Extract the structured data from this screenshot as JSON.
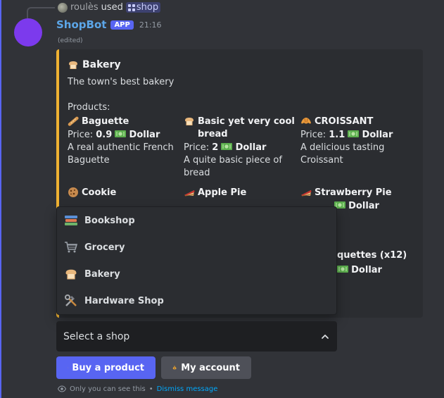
{
  "reply": {
    "user": "roulès",
    "used": "used",
    "command": "shop"
  },
  "message": {
    "author": "ShopBot",
    "badge": "APP",
    "time": "21:16",
    "edited": "(edited)"
  },
  "embed": {
    "accent_color": "#f0b232",
    "title": "Bakery",
    "title_icon": "bread-icon",
    "description": "The town's best bakery\n\nProducts:",
    "products": [
      {
        "name": "Baguette",
        "icon": "baguette-icon",
        "price_label": "Price:",
        "price": "0.9",
        "currency": "Dollar",
        "description": "A real authentic French Baguette"
      },
      {
        "name": "Basic yet very cool bread",
        "icon": "bread-icon",
        "price_label": "Price:",
        "price": "2",
        "currency": "Dollar",
        "description": "A quite basic piece of bread"
      },
      {
        "name": "CROISSANT",
        "icon": "croissant-icon",
        "price_label": "Price:",
        "price": "1.1",
        "currency": "Dollar",
        "description": "A delicious tasting Croissant"
      },
      {
        "name": "Cookie",
        "icon": "cookie-icon"
      },
      {
        "name": "Apple Pie",
        "icon": "pie-icon"
      },
      {
        "name": "Strawberry Pie",
        "icon": "pie-icon",
        "currency": "Dollar"
      }
    ],
    "partial_product": {
      "name_fragment": "quettes (x12)",
      "currency": "Dollar"
    }
  },
  "dropdown": {
    "options": [
      {
        "label": "Bookshop",
        "icon": "books-icon"
      },
      {
        "label": "Grocery",
        "icon": "shopping-cart-icon"
      },
      {
        "label": "Bakery",
        "icon": "bread-icon"
      },
      {
        "label": "Hardware Shop",
        "icon": "hammer-wrench-icon"
      }
    ]
  },
  "select": {
    "placeholder": "Select a shop"
  },
  "buttons": {
    "buy": "Buy a product",
    "account": "My account"
  },
  "footer": {
    "visibility": "Only you can see this",
    "separator": "•",
    "dismiss": "Dismiss message"
  },
  "colors": {
    "blurple": "#5865f2",
    "background": "#313338",
    "embed": "#2b2d31",
    "link": "#00a8fc"
  }
}
